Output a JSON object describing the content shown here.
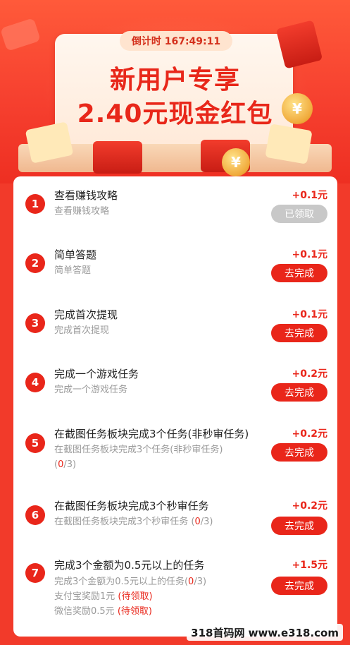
{
  "header": {
    "countdown": "倒计时 167:49:11",
    "title_line1": "新用户专享",
    "title_line2": "2.40元现金红包"
  },
  "tasks": [
    {
      "num": "1",
      "title": "查看赚钱攻略",
      "subtitle": "查看赚钱攻略",
      "reward": "+0.1元",
      "button": "已领取",
      "state": "claimed"
    },
    {
      "num": "2",
      "title": "简单答题",
      "subtitle": "简单答题",
      "reward": "+0.1元",
      "button": "去完成",
      "state": "todo"
    },
    {
      "num": "3",
      "title": "完成首次提现",
      "subtitle": "完成首次提现",
      "reward": "+0.1元",
      "button": "去完成",
      "state": "todo"
    },
    {
      "num": "4",
      "title": "完成一个游戏任务",
      "subtitle": "完成一个游戏任务",
      "reward": "+0.2元",
      "button": "去完成",
      "state": "todo"
    },
    {
      "num": "5",
      "title": "在截图任务板块完成3个任务(非秒审任务)",
      "subtitle": "在截图任务板块完成3个任务(非秒审任务)",
      "progress": "(0/3)",
      "progress_value": "0",
      "progress_total": "/3)",
      "reward": "+0.2元",
      "button": "去完成",
      "state": "todo"
    },
    {
      "num": "6",
      "title": "在截图任务板块完成3个秒审任务",
      "subtitle": "在截图任务板块完成3个秒审任务",
      "progress_value": "0",
      "progress_total": "/3)",
      "reward": "+0.2元",
      "button": "去完成",
      "state": "todo"
    },
    {
      "num": "7",
      "title": "完成3个金额为0.5元以上的任务",
      "subtitle": "完成3个金额为0.5元以上的任务",
      "progress_value": "0",
      "progress_total": "/3)",
      "extra1": "支付宝奖励1元",
      "extra1_tag": "(待领取)",
      "extra2": "微信奖励0.5元",
      "extra2_tag": "(待领取)",
      "reward": "+1.5元",
      "button": "去完成",
      "state": "todo"
    }
  ],
  "watermark": "318首码网 www.e318.com",
  "colors": {
    "primary": "#e9261a",
    "background": "#f23a2a",
    "muted": "#9a9a9a"
  }
}
